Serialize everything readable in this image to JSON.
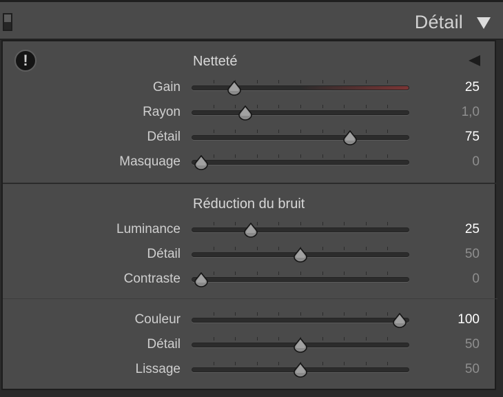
{
  "header": {
    "title": "Détail"
  },
  "sharpening": {
    "title": "Netteté",
    "rows": [
      {
        "label": "Gain",
        "value": "25",
        "fraction": 0.1667,
        "active": true
      },
      {
        "label": "Rayon",
        "value": "1,0",
        "fraction": 0.2222,
        "active": false
      },
      {
        "label": "Détail",
        "value": "75",
        "fraction": 0.75,
        "active": true
      },
      {
        "label": "Masquage",
        "value": "0",
        "fraction": 0.0,
        "active": false
      }
    ]
  },
  "noise_reduction": {
    "title": "Réduction du bruit",
    "rows": [
      {
        "label": "Luminance",
        "value": "25",
        "fraction": 0.25,
        "active": true
      },
      {
        "label": "Détail",
        "value": "50",
        "fraction": 0.5,
        "active": false
      },
      {
        "label": "Contraste",
        "value": "0",
        "fraction": 0.0,
        "active": false
      }
    ],
    "color_rows": [
      {
        "label": "Couleur",
        "value": "100",
        "fraction": 1.0,
        "active": true
      },
      {
        "label": "Détail",
        "value": "50",
        "fraction": 0.5,
        "active": false
      },
      {
        "label": "Lissage",
        "value": "50",
        "fraction": 0.5,
        "active": false
      }
    ]
  },
  "icons": {
    "panel_toggle": "panel-toggle-icon",
    "collapse": "collapse-triangle-icon",
    "warning": "exclamation-icon"
  },
  "colors": {
    "gain_track_accent": "#7a3535"
  }
}
